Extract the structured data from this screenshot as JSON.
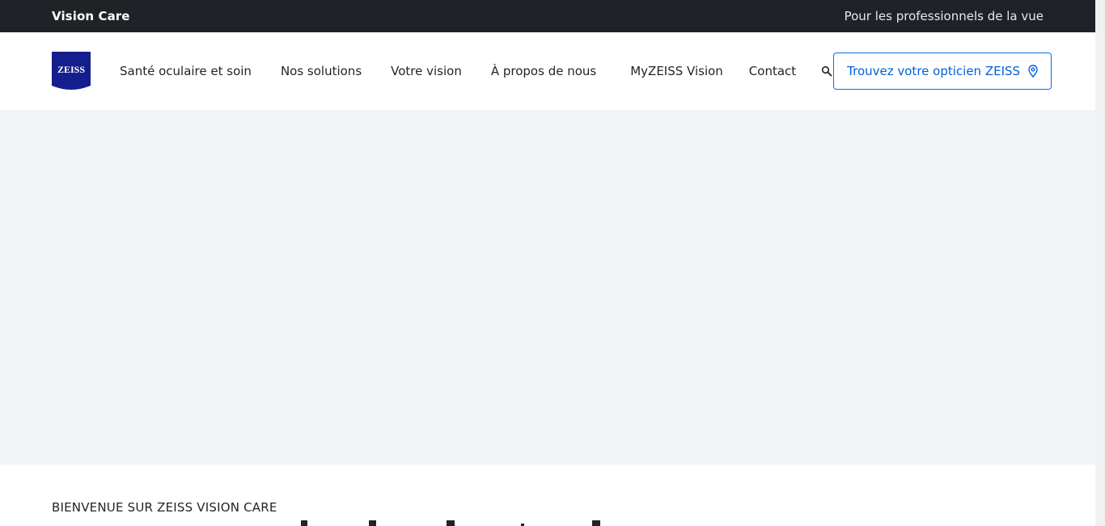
{
  "topbar": {
    "brand": "Vision Care",
    "professionals_link": "Pour les professionnels de la vue"
  },
  "header": {
    "logo_text": "ZEISS",
    "nav": [
      {
        "label": "Santé oculaire et soin"
      },
      {
        "label": "Nos solutions"
      },
      {
        "label": "Votre vision"
      },
      {
        "label": "À propos de nous"
      },
      {
        "label": "MyZEISS Vision"
      },
      {
        "label": "Contact"
      }
    ],
    "search_icon": "search-icon",
    "cta_label": "Trouvez votre opticien ZEISS",
    "cta_icon": "location-pin-icon"
  },
  "intro": {
    "eyebrow": "BIENVENUE SUR ZEISS VISION CARE"
  },
  "colors": {
    "topbar_bg": "#1f2328",
    "brand_blue": "#141e8c",
    "accent": "#0072ef",
    "hero_bg": "#f2f5f8"
  }
}
